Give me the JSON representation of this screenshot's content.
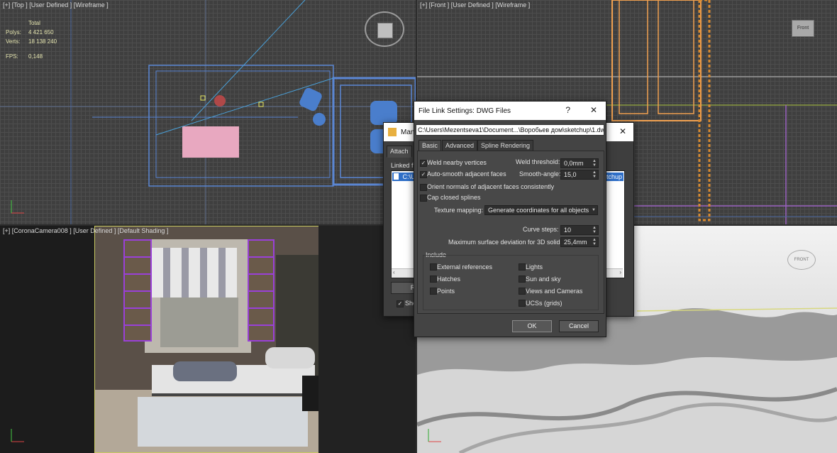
{
  "viewports": {
    "top": {
      "label": "[+] [Top ] [User Defined ] [Wireframe ]"
    },
    "front": {
      "label": "[+] [Front ] [User Defined ] [Wireframe ]"
    },
    "camera": {
      "label": "[+] [CoronaCamera008 ] [User Defined ] [Default Shading ]"
    }
  },
  "stats": {
    "header": "Total",
    "polys_label": "Polys:",
    "polys_value": "4 421 650",
    "verts_label": "Verts:",
    "verts_value": "18 138 240",
    "fps_label": "FPS:",
    "fps_value": "0,148"
  },
  "viewcube": {
    "front_label": "Front",
    "front_label_persp": "FRONT"
  },
  "manager_dialog": {
    "title": "Man",
    "attach_tab": "Attach",
    "linked_label": "Linked fil",
    "path_prefix": "C:\\U",
    "path_suffix": "ketchup",
    "reload_label": "R",
    "show_label": "Sho"
  },
  "dwg_dialog": {
    "title": "File Link Settings: DWG Files",
    "help": "?",
    "close": "✕",
    "path": "C:\\Users\\Mezentseva1\\Document...\\Воробьев дом\\sketchup\\1.dwg",
    "tabs": [
      "Basic",
      "Advanced",
      "Spline Rendering"
    ],
    "weld_vertices": "Weld nearby vertices",
    "weld_threshold_label": "Weld threshold:",
    "weld_threshold_value": "0,0mm",
    "auto_smooth": "Auto-smooth adjacent faces",
    "smooth_angle_label": "Smooth-angle:",
    "smooth_angle_value": "15,0",
    "orient_normals": "Orient normals of adjacent faces consistently",
    "cap_splines": "Cap closed splines",
    "texture_mapping_label": "Texture mapping:",
    "texture_mapping_value": "Generate coordinates for all objects",
    "curve_steps_label": "Curve steps:",
    "curve_steps_value": "10",
    "max_dev_label": "Maximum surface deviation for 3D solids:",
    "max_dev_value": "25,4mm",
    "include_label": "Include",
    "include_left": [
      "External references",
      "Hatches",
      "Points"
    ],
    "include_right": [
      "Lights",
      "Sun and sky",
      "Views and Cameras",
      "UCSs (grids)"
    ],
    "ok": "OK",
    "cancel": "Cancel"
  }
}
